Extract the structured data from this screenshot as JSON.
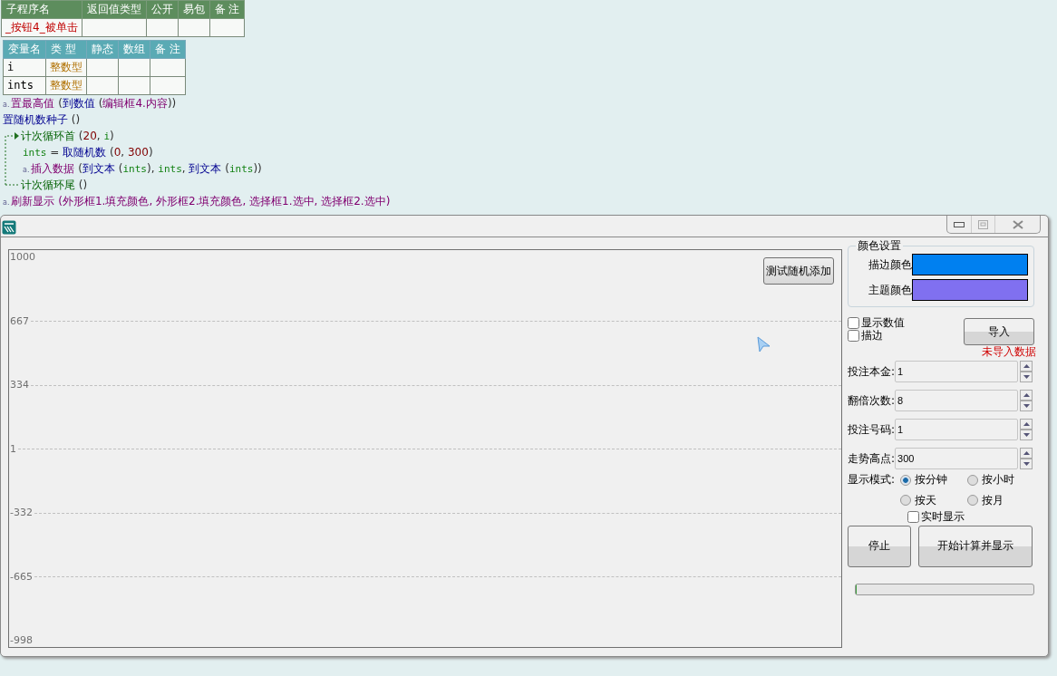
{
  "sub_table": {
    "columns": [
      "子程序名",
      "返回值类型",
      "公开",
      "易包",
      "备 注"
    ],
    "rows": [
      [
        "_按钮4_被单击",
        "",
        "",
        "",
        ""
      ]
    ]
  },
  "var_table": {
    "columns": [
      "变量名",
      "类 型",
      "静态",
      "数组",
      "备 注"
    ],
    "rows": [
      [
        "i",
        "整数型",
        "",
        "",
        ""
      ],
      [
        "ints",
        "整数型",
        "",
        "",
        ""
      ]
    ]
  },
  "code": [
    {
      "kind": "line",
      "tokens": [
        {
          "kind": "marker",
          "text": "a."
        },
        {
          "kind": "cmd",
          "text": "置最高值"
        },
        {
          "kind": "plain",
          "text": " ("
        },
        {
          "kind": "func",
          "text": "到数值"
        },
        {
          "kind": "plain",
          "text": " ("
        },
        {
          "kind": "cmd",
          "text": "编辑框4.内容"
        },
        {
          "kind": "plain",
          "text": "))"
        }
      ]
    },
    {
      "kind": "line",
      "tokens": [
        {
          "kind": "func",
          "text": "置随机数种子"
        },
        {
          "kind": "plain",
          "text": " ()"
        }
      ]
    },
    {
      "kind": "loop",
      "head": [
        {
          "kind": "loop",
          "text": "计次循环首"
        },
        {
          "kind": "plain",
          "text": " ("
        },
        {
          "kind": "num",
          "text": "20"
        },
        {
          "kind": "plain",
          "text": ", "
        },
        {
          "kind": "var",
          "text": "i"
        },
        {
          "kind": "plain",
          "text": ")"
        }
      ],
      "children": [
        {
          "kind": "line",
          "tokens": [
            {
              "kind": "var",
              "text": "ints"
            },
            {
              "kind": "plain",
              "text": " = "
            },
            {
              "kind": "func",
              "text": "取随机数"
            },
            {
              "kind": "plain",
              "text": " ("
            },
            {
              "kind": "num",
              "text": "0"
            },
            {
              "kind": "plain",
              "text": ", "
            },
            {
              "kind": "num",
              "text": "300"
            },
            {
              "kind": "plain",
              "text": ")"
            }
          ]
        },
        {
          "kind": "line",
          "tokens": [
            {
              "kind": "marker",
              "text": "a."
            },
            {
              "kind": "cmd",
              "text": "插入数据"
            },
            {
              "kind": "plain",
              "text": " ("
            },
            {
              "kind": "func",
              "text": "到文本"
            },
            {
              "kind": "plain",
              "text": " ("
            },
            {
              "kind": "var",
              "text": "ints"
            },
            {
              "kind": "plain",
              "text": "), "
            },
            {
              "kind": "var",
              "text": "ints"
            },
            {
              "kind": "plain",
              "text": ", "
            },
            {
              "kind": "func",
              "text": "到文本"
            },
            {
              "kind": "plain",
              "text": " ("
            },
            {
              "kind": "var",
              "text": "ints"
            },
            {
              "kind": "plain",
              "text": "))"
            }
          ]
        }
      ],
      "tail": [
        {
          "kind": "loop",
          "text": "计次循环尾"
        },
        {
          "kind": "plain",
          "text": " ()"
        }
      ]
    },
    {
      "kind": "line",
      "tokens": [
        {
          "kind": "marker",
          "text": "a."
        },
        {
          "kind": "cmd",
          "text": "刷新显示 (外形框1.填充颜色, 外形框2.填充颜色, 选择框1.选中, 选择框2.选中)"
        }
      ]
    }
  ],
  "window": {
    "chart": {
      "y_labels": [
        {
          "text": "1000",
          "gridline": false
        },
        {
          "text": "667",
          "gridline": true
        },
        {
          "text": "334",
          "gridline": true
        },
        {
          "text": "1",
          "gridline": true
        },
        {
          "text": "-332",
          "gridline": true
        },
        {
          "text": "-665",
          "gridline": true
        },
        {
          "text": "-998",
          "gridline": false
        }
      ],
      "test_button": "测试随机添加"
    },
    "color_group": {
      "title": "颜色设置",
      "items": [
        {
          "label": "描边颜色",
          "color": "#0080f0"
        },
        {
          "label": "主题颜色",
          "color": "#8070f0"
        }
      ]
    },
    "checkboxes": [
      {
        "label": "显示数值",
        "checked": false
      },
      {
        "label": "描边",
        "checked": false
      }
    ],
    "import_button": "导入",
    "import_status": "未导入数据",
    "spinners": [
      {
        "label": "投注本金:",
        "value": "1"
      },
      {
        "label": "翻倍次数:",
        "value": "8"
      },
      {
        "label": "投注号码:",
        "value": "1"
      },
      {
        "label": "走势高点:",
        "value": "300"
      }
    ],
    "mode": {
      "label": "显示模式:",
      "options": [
        {
          "label": "按分钟",
          "selected": true
        },
        {
          "label": "按小时",
          "selected": false
        },
        {
          "label": "按天",
          "selected": false
        },
        {
          "label": "按月",
          "selected": false
        }
      ]
    },
    "realtime": {
      "label": "实时显示",
      "checked": false
    },
    "stop_button": "停止",
    "start_button": "开始计算并显示",
    "progress": {
      "level": 0
    }
  }
}
